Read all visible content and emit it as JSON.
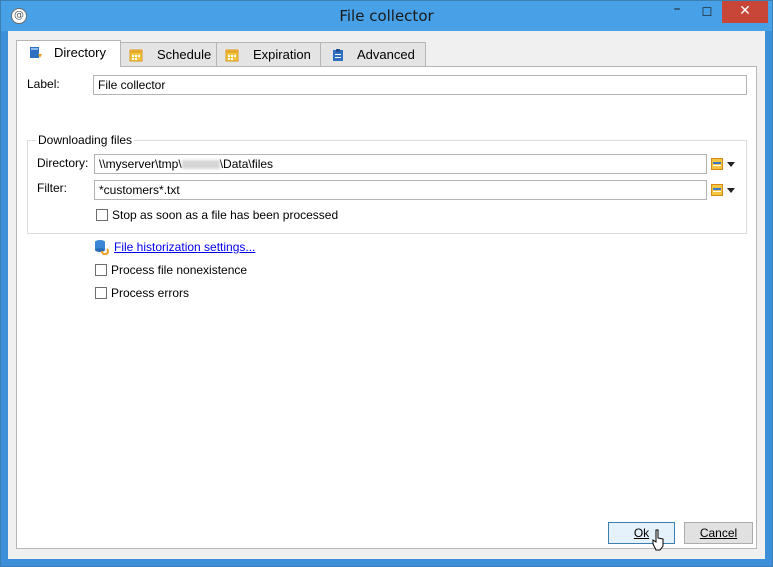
{
  "window": {
    "title": "File collector"
  },
  "window_controls": {
    "minimize": "–",
    "maximize": "☐",
    "close": "✕"
  },
  "tabs": [
    {
      "label": "Directory",
      "icon": "folder-download-icon",
      "active": true
    },
    {
      "label": "Schedule",
      "icon": "calendar-icon",
      "active": false
    },
    {
      "label": "Expiration",
      "icon": "calendar-icon",
      "active": false
    },
    {
      "label": "Advanced",
      "icon": "clipboard-icon",
      "active": false
    }
  ],
  "form": {
    "label_caption": "Label:",
    "label_value": "File collector",
    "downloading_group": "Downloading files",
    "directory_caption": "Directory:",
    "directory_value_start": "\\\\myserver\\tmp\\",
    "directory_value_end": "\\Data\\files",
    "filter_caption": "Filter:",
    "filter_value": "*customers*.txt",
    "stop_checkbox": "Stop as soon as a file has been processed",
    "historization_link": "File historization settings...",
    "nonexistence_checkbox": "Process file nonexistence",
    "errors_checkbox": "Process errors"
  },
  "buttons": {
    "ok_label": "Ok",
    "cancel_label": "Cancel"
  },
  "colors": {
    "titlebar": "#48a0e6",
    "close_button": "#c74637",
    "link": "#0000ee"
  }
}
